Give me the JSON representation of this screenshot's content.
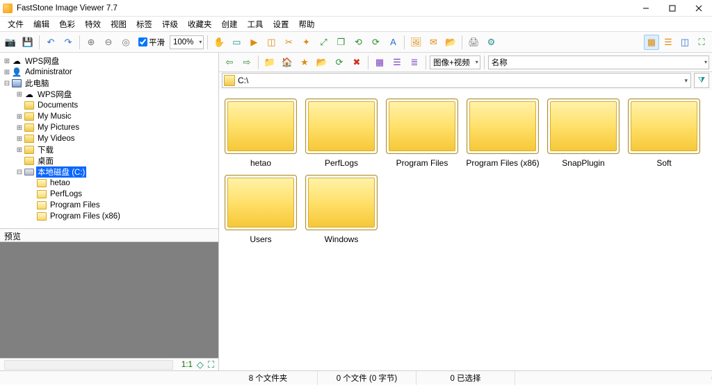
{
  "app": {
    "title": "FastStone Image Viewer 7.7"
  },
  "menu": {
    "file": "文件",
    "edit": "编辑",
    "color": "色彩",
    "effects": "特效",
    "view": "视图",
    "tags": "标签",
    "rating": "评级",
    "favorites": "收藏夹",
    "create": "创建",
    "tools": "工具",
    "settings": "设置",
    "help": "帮助"
  },
  "toolbar": {
    "smooth_label": "平滑",
    "zoom_value": "100%"
  },
  "tree": {
    "items": [
      {
        "indent": 0,
        "exp": "+",
        "icon": "cloud",
        "label": "WPS网盘"
      },
      {
        "indent": 0,
        "exp": "+",
        "icon": "user",
        "label": "Administrator"
      },
      {
        "indent": 0,
        "exp": "-",
        "icon": "computer",
        "label": "此电脑"
      },
      {
        "indent": 1,
        "exp": "+",
        "icon": "cloud",
        "label": "WPS网盘"
      },
      {
        "indent": 1,
        "exp": "",
        "icon": "folder",
        "label": "Documents"
      },
      {
        "indent": 1,
        "exp": "+",
        "icon": "folder",
        "label": "My Music"
      },
      {
        "indent": 1,
        "exp": "+",
        "icon": "folder",
        "label": "My Pictures"
      },
      {
        "indent": 1,
        "exp": "+",
        "icon": "folder",
        "label": "My Videos"
      },
      {
        "indent": 1,
        "exp": "+",
        "icon": "folder",
        "label": "下载"
      },
      {
        "indent": 1,
        "exp": "",
        "icon": "folder",
        "label": "桌面"
      },
      {
        "indent": 1,
        "exp": "-",
        "icon": "drive",
        "label": "本地磁盘 (C:)",
        "selected": true
      },
      {
        "indent": 2,
        "exp": "",
        "icon": "folder-open",
        "label": "hetao"
      },
      {
        "indent": 2,
        "exp": "",
        "icon": "folder-open",
        "label": "PerfLogs"
      },
      {
        "indent": 2,
        "exp": "",
        "icon": "folder-open",
        "label": "Program Files"
      },
      {
        "indent": 2,
        "exp": "",
        "icon": "folder-open",
        "label": "Program Files (x86)"
      }
    ]
  },
  "preview": {
    "header": "预览",
    "ratio": "1:1"
  },
  "rtoolbar": {
    "filter_label": "图像+视频",
    "sort_label": "名称"
  },
  "address": {
    "path": "C:\\"
  },
  "folders": [
    {
      "name": "hetao"
    },
    {
      "name": "PerfLogs"
    },
    {
      "name": "Program Files"
    },
    {
      "name": "Program Files (x86)"
    },
    {
      "name": "SnapPlugin"
    },
    {
      "name": "Soft"
    },
    {
      "name": "Users"
    },
    {
      "name": "Windows"
    }
  ],
  "status": {
    "folders": "8 个文件夹",
    "files": "0 个文件 (0 字节)",
    "selected": "0 已选择"
  }
}
